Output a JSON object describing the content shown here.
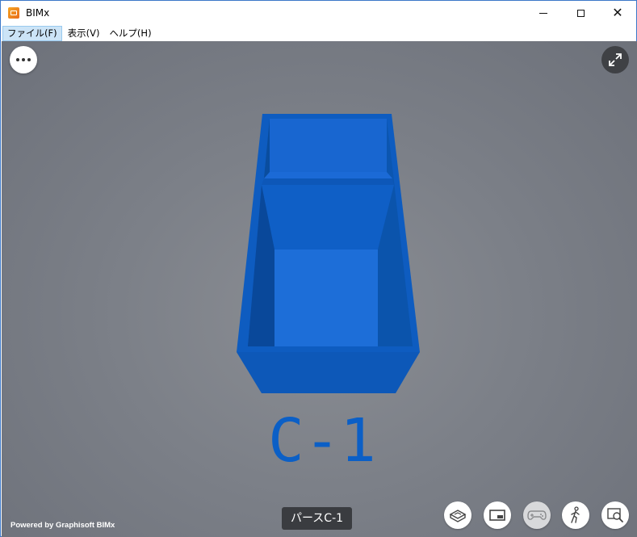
{
  "window": {
    "title": "BIMx",
    "icon": "bimx-app-icon",
    "controls": [
      "minimize",
      "maximize",
      "close"
    ]
  },
  "menu": {
    "items": [
      {
        "label": "ファイル(F)",
        "active": true
      },
      {
        "label": "表示(V)",
        "active": false
      },
      {
        "label": "ヘルプ(H)",
        "active": false
      }
    ]
  },
  "viewport": {
    "model_label": "C-1",
    "model_color": "#0a5fc4",
    "view_name": "パースC-1",
    "powered_by": "Powered by Graphisoft BIMx",
    "buttons": {
      "more": "more-icon",
      "fullscreen": "expand-icon"
    },
    "toolbar": [
      {
        "name": "3d-view-icon",
        "enabled": true
      },
      {
        "name": "floor-plan-icon",
        "enabled": true
      },
      {
        "name": "gamepad-icon",
        "enabled": false
      },
      {
        "name": "walk-icon",
        "enabled": true
      },
      {
        "name": "search-view-icon",
        "enabled": true
      }
    ]
  }
}
